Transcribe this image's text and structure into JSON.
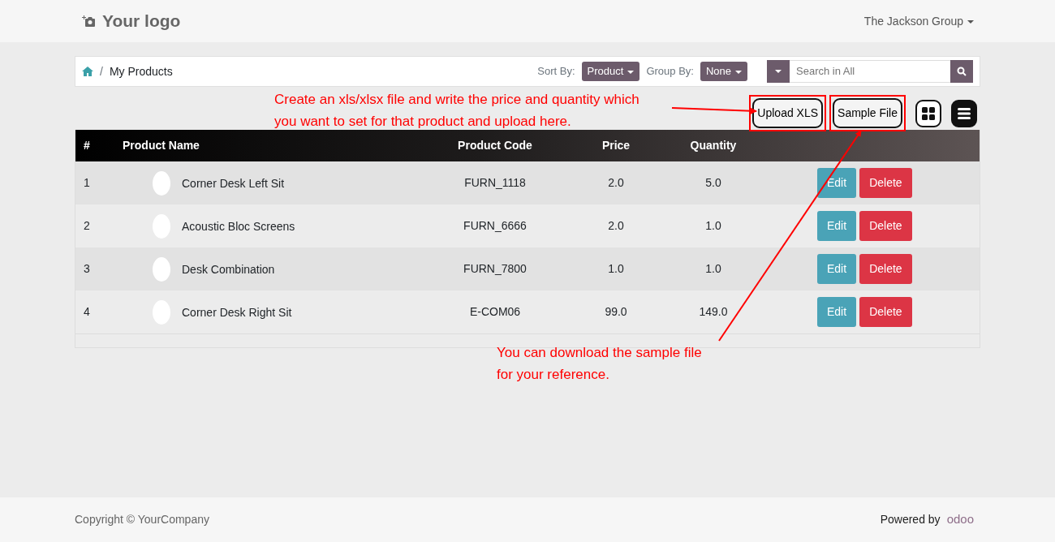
{
  "navbar": {
    "logo": "Your logo",
    "company": "The Jackson Group"
  },
  "breadcrumb": {
    "separator": "/",
    "items": [
      "My Products"
    ]
  },
  "sort_by": {
    "label": "Sort By:",
    "value": "Product"
  },
  "group_by": {
    "label": "Group By:",
    "value": "None"
  },
  "search": {
    "placeholder": "Search in All"
  },
  "toolbar": {
    "buttons": [
      {
        "label": "Upload XLS",
        "highlighted": true
      },
      {
        "label": "Sample File",
        "highlighted": true
      }
    ],
    "views": [
      {
        "kind": "grid",
        "selected": false
      },
      {
        "kind": "list",
        "selected": true
      }
    ]
  },
  "annotations": [
    {
      "text": "Create an xls/xlsx file and write the price and quantity which you want to set for that product and upload here."
    },
    {
      "text": "You can download the sample file for your reference."
    }
  ],
  "table": {
    "columns": [
      "#",
      "Product Name",
      "Product Code",
      "Price",
      "Quantity"
    ],
    "rows": [
      {
        "number": "1",
        "name": "Corner Desk Left Sit",
        "code": "FURN_1118",
        "price": "2.0",
        "quantity": "5.0",
        "actions": [
          "Edit",
          "Delete"
        ]
      },
      {
        "number": "2",
        "name": "Acoustic Bloc Screens",
        "code": "FURN_6666",
        "price": "2.0",
        "quantity": "1.0",
        "actions": [
          "Edit",
          "Delete"
        ]
      },
      {
        "number": "3",
        "name": "Desk Combination",
        "code": "FURN_7800",
        "price": "1.0",
        "quantity": "1.0",
        "actions": [
          "Edit",
          "Delete"
        ]
      },
      {
        "number": "4",
        "name": "Corner Desk Right Sit",
        "code": "E-COM06",
        "price": "99.0",
        "quantity": "149.0",
        "actions": [
          "Edit",
          "Delete"
        ]
      }
    ]
  },
  "footer": {
    "copyright": "Copyright © YourCompany",
    "powered_by": "Powered by",
    "brand": "odoo"
  }
}
